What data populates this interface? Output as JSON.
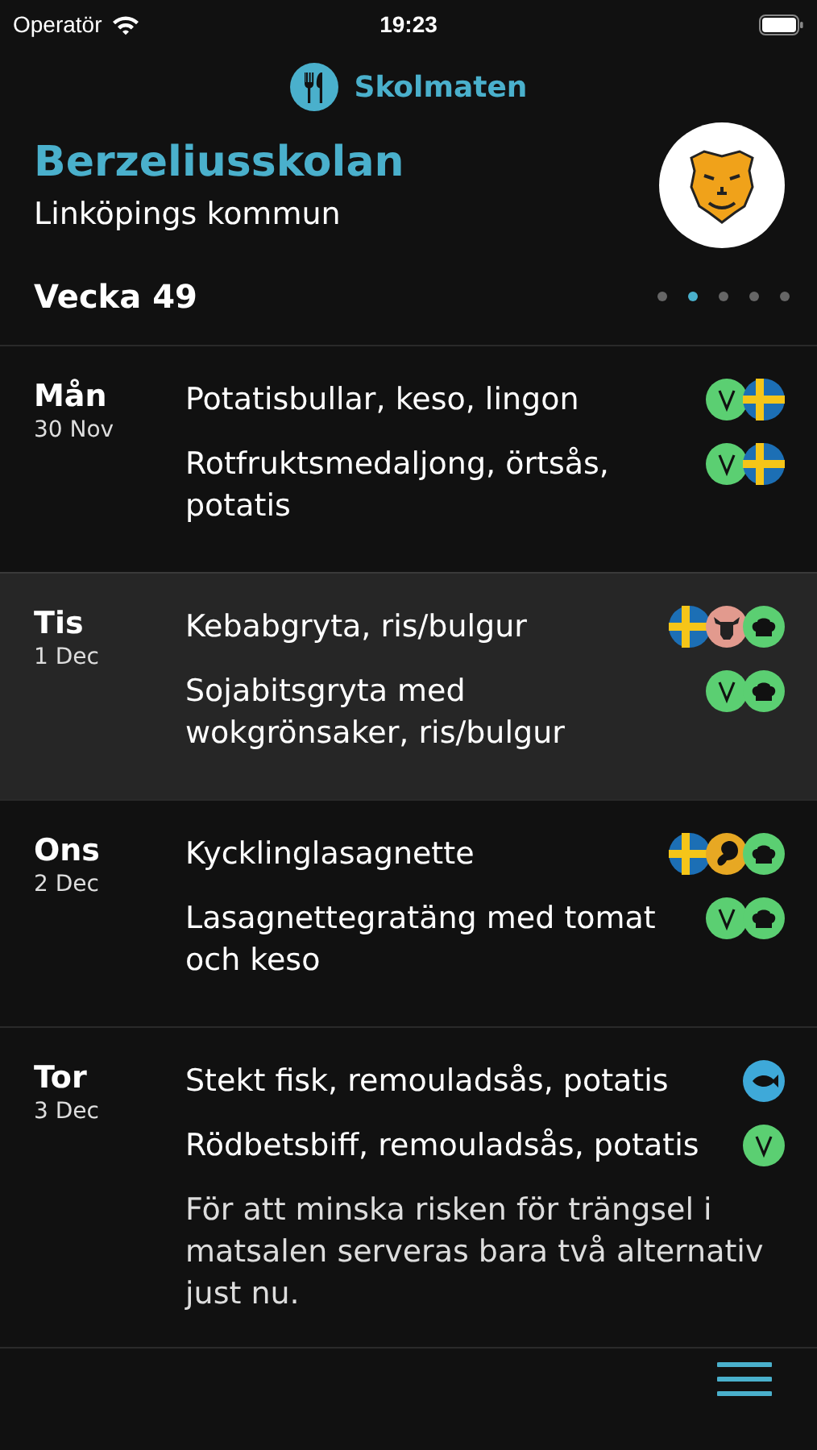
{
  "status_bar": {
    "carrier": "Operatör",
    "time": "19:23"
  },
  "app": {
    "title": "Skolmaten"
  },
  "school": {
    "name": "Berzeliusskolan",
    "municipality": "Linköpings kommun"
  },
  "week": {
    "label": "Vecka 49",
    "pages": [
      {
        "selected": false
      },
      {
        "selected": true
      },
      {
        "selected": false
      },
      {
        "selected": false
      },
      {
        "selected": false
      }
    ]
  },
  "days": [
    {
      "name": "Mån",
      "date": "30 Nov",
      "selected": false,
      "dishes": [
        {
          "text": "Potatisbullar, keso, lingon",
          "tags": [
            {
              "kind": "vegetarian"
            },
            {
              "kind": "swedish"
            }
          ]
        },
        {
          "text": "Rotfruktsmedaljong, örtsås, potatis",
          "tags": [
            {
              "kind": "vegetarian"
            },
            {
              "kind": "swedish"
            }
          ]
        }
      ]
    },
    {
      "name": "Tis",
      "date": "1 Dec",
      "selected": true,
      "dishes": [
        {
          "text": "Kebabgryta, ris/bulgur",
          "tags": [
            {
              "kind": "swedish"
            },
            {
              "kind": "beef"
            },
            {
              "kind": "chef"
            }
          ]
        },
        {
          "text": "Sojabitsgryta med wokgrönsaker, ris/bulgur",
          "tags": [
            {
              "kind": "vegetarian"
            },
            {
              "kind": "chef"
            }
          ]
        }
      ]
    },
    {
      "name": "Ons",
      "date": "2 Dec",
      "selected": false,
      "dishes": [
        {
          "text": "Kycklinglasagnette",
          "tags": [
            {
              "kind": "swedish"
            },
            {
              "kind": "chicken"
            },
            {
              "kind": "chef"
            }
          ]
        },
        {
          "text": "Lasagnettegratäng med tomat och keso",
          "tags": [
            {
              "kind": "vegetarian"
            },
            {
              "kind": "chef"
            }
          ]
        }
      ]
    },
    {
      "name": "Tor",
      "date": "3 Dec",
      "selected": false,
      "dishes": [
        {
          "text": "Stekt fisk, remouladsås, potatis",
          "tags": [
            {
              "kind": "fish"
            }
          ]
        },
        {
          "text": "Rödbetsbiff, remouladsås, potatis",
          "tags": [
            {
              "kind": "vegetarian"
            }
          ]
        }
      ],
      "note": "För att minska risken för trängsel i matsalen serveras bara två alternativ just nu."
    }
  ]
}
